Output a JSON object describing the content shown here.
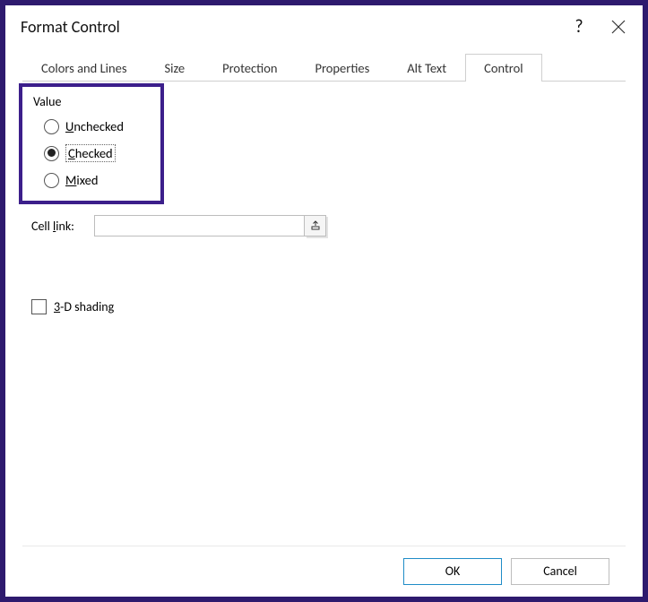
{
  "titlebar": {
    "title": "Format Control",
    "help": "?",
    "close": "×"
  },
  "tabs": [
    {
      "label": "Colors and Lines"
    },
    {
      "label": "Size"
    },
    {
      "label": "Protection"
    },
    {
      "label": "Properties"
    },
    {
      "label": "Alt Text"
    },
    {
      "label": "Control"
    }
  ],
  "active_tab": "Control",
  "value": {
    "section_label": "Value",
    "unchecked": {
      "key": "U",
      "rest": "nchecked"
    },
    "checked": {
      "key": "C",
      "rest": "hecked"
    },
    "mixed": {
      "key": "M",
      "rest": "ixed"
    },
    "selected": "checked"
  },
  "cell_link": {
    "label_pre": "Cell ",
    "label_key": "l",
    "label_post": "ink:",
    "value": ""
  },
  "shading": {
    "key": "3",
    "rest": "-D shading",
    "checked": false
  },
  "footer": {
    "ok": "OK",
    "cancel": "Cancel"
  }
}
